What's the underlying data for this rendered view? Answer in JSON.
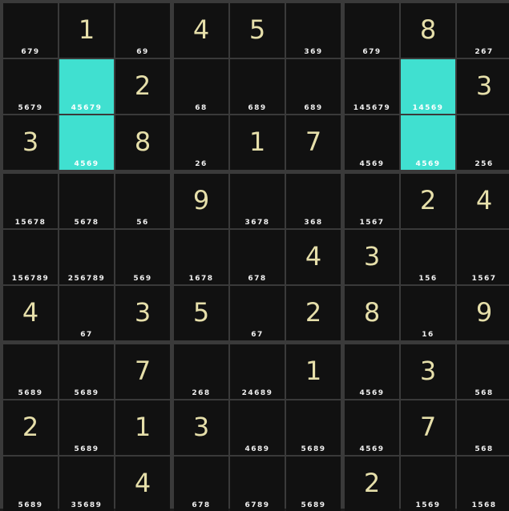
{
  "board": {
    "colors": {
      "background": "#111111",
      "grid": "#3a3a3a",
      "digit": "#e6dfaa",
      "notes": "#f0f0f0",
      "highlight": "#40e0d0"
    },
    "cells": [
      [
        {
          "digit": "",
          "notes": "679"
        },
        {
          "digit": "1",
          "notes": ""
        },
        {
          "digit": "",
          "notes": "69"
        },
        {
          "digit": "4",
          "notes": ""
        },
        {
          "digit": "5",
          "notes": ""
        },
        {
          "digit": "",
          "notes": "369"
        },
        {
          "digit": "",
          "notes": "679"
        },
        {
          "digit": "8",
          "notes": ""
        },
        {
          "digit": "",
          "notes": "267"
        }
      ],
      [
        {
          "digit": "",
          "notes": "5679"
        },
        {
          "digit": "",
          "notes": "45679",
          "highlight": true
        },
        {
          "digit": "2",
          "notes": ""
        },
        {
          "digit": "",
          "notes": "68"
        },
        {
          "digit": "",
          "notes": "689"
        },
        {
          "digit": "",
          "notes": "689"
        },
        {
          "digit": "",
          "notes": "145679"
        },
        {
          "digit": "",
          "notes": "14569",
          "highlight": true
        },
        {
          "digit": "3",
          "notes": ""
        }
      ],
      [
        {
          "digit": "3",
          "notes": ""
        },
        {
          "digit": "",
          "notes": "4569",
          "highlight": true
        },
        {
          "digit": "8",
          "notes": ""
        },
        {
          "digit": "",
          "notes": "26"
        },
        {
          "digit": "1",
          "notes": ""
        },
        {
          "digit": "7",
          "notes": ""
        },
        {
          "digit": "",
          "notes": "4569"
        },
        {
          "digit": "",
          "notes": "4569",
          "highlight": true
        },
        {
          "digit": "",
          "notes": "256"
        }
      ],
      [
        {
          "digit": "",
          "notes": "15678"
        },
        {
          "digit": "",
          "notes": "5678"
        },
        {
          "digit": "",
          "notes": "56"
        },
        {
          "digit": "9",
          "notes": ""
        },
        {
          "digit": "",
          "notes": "3678"
        },
        {
          "digit": "",
          "notes": "368"
        },
        {
          "digit": "",
          "notes": "1567"
        },
        {
          "digit": "2",
          "notes": ""
        },
        {
          "digit": "4",
          "notes": ""
        }
      ],
      [
        {
          "digit": "",
          "notes": "156789"
        },
        {
          "digit": "",
          "notes": "256789"
        },
        {
          "digit": "",
          "notes": "569"
        },
        {
          "digit": "",
          "notes": "1678"
        },
        {
          "digit": "",
          "notes": "678"
        },
        {
          "digit": "4",
          "notes": ""
        },
        {
          "digit": "3",
          "notes": ""
        },
        {
          "digit": "",
          "notes": "156"
        },
        {
          "digit": "",
          "notes": "1567"
        }
      ],
      [
        {
          "digit": "4",
          "notes": ""
        },
        {
          "digit": "",
          "notes": "67"
        },
        {
          "digit": "3",
          "notes": ""
        },
        {
          "digit": "5",
          "notes": ""
        },
        {
          "digit": "",
          "notes": "67"
        },
        {
          "digit": "2",
          "notes": ""
        },
        {
          "digit": "8",
          "notes": ""
        },
        {
          "digit": "",
          "notes": "16"
        },
        {
          "digit": "9",
          "notes": ""
        }
      ],
      [
        {
          "digit": "",
          "notes": "5689"
        },
        {
          "digit": "",
          "notes": "5689"
        },
        {
          "digit": "7",
          "notes": ""
        },
        {
          "digit": "",
          "notes": "268"
        },
        {
          "digit": "",
          "notes": "24689"
        },
        {
          "digit": "1",
          "notes": ""
        },
        {
          "digit": "",
          "notes": "4569"
        },
        {
          "digit": "3",
          "notes": ""
        },
        {
          "digit": "",
          "notes": "568"
        }
      ],
      [
        {
          "digit": "2",
          "notes": ""
        },
        {
          "digit": "",
          "notes": "5689"
        },
        {
          "digit": "1",
          "notes": ""
        },
        {
          "digit": "3",
          "notes": ""
        },
        {
          "digit": "",
          "notes": "4689"
        },
        {
          "digit": "",
          "notes": "5689"
        },
        {
          "digit": "",
          "notes": "4569"
        },
        {
          "digit": "7",
          "notes": ""
        },
        {
          "digit": "",
          "notes": "568"
        }
      ],
      [
        {
          "digit": "",
          "notes": "5689"
        },
        {
          "digit": "",
          "notes": "35689"
        },
        {
          "digit": "4",
          "notes": ""
        },
        {
          "digit": "",
          "notes": "678"
        },
        {
          "digit": "",
          "notes": "6789"
        },
        {
          "digit": "",
          "notes": "5689"
        },
        {
          "digit": "2",
          "notes": ""
        },
        {
          "digit": "",
          "notes": "1569"
        },
        {
          "digit": "",
          "notes": "1568"
        }
      ]
    ]
  }
}
